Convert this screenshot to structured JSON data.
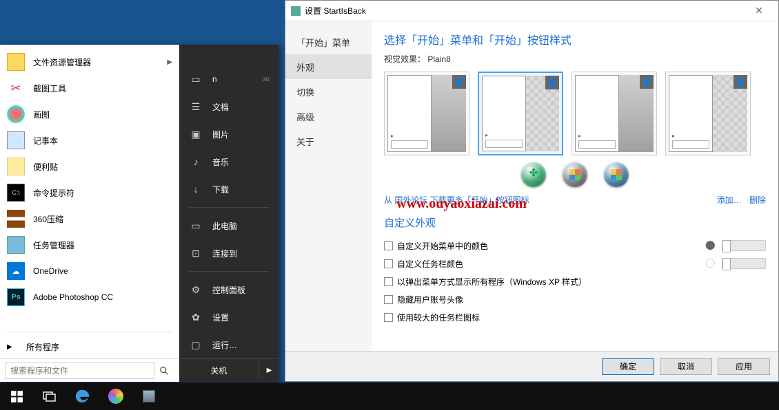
{
  "startMenu": {
    "left": [
      {
        "icon": "folder",
        "label": "文件资源管理器",
        "hasArrow": true
      },
      {
        "icon": "snip",
        "label": "截图工具"
      },
      {
        "icon": "paint",
        "label": "画图"
      },
      {
        "icon": "notepad",
        "label": "记事本"
      },
      {
        "icon": "sticky",
        "label": "便利贴"
      },
      {
        "icon": "cmd",
        "label": "命令提示符"
      },
      {
        "icon": "zip",
        "label": "360压缩"
      },
      {
        "icon": "task",
        "label": "任务管理器"
      },
      {
        "icon": "od",
        "label": "OneDrive"
      },
      {
        "icon": "ps",
        "label": "Adobe Photoshop CC"
      }
    ],
    "allPrograms": "所有程序",
    "searchPlaceholder": "搜索程序和文件",
    "right": [
      {
        "icon": "user",
        "label": "n",
        "extra": "ɜo"
      },
      {
        "icon": "doc",
        "label": "文档"
      },
      {
        "icon": "pic",
        "label": "图片"
      },
      {
        "icon": "music",
        "label": "音乐"
      },
      {
        "icon": "dl",
        "label": "下载"
      },
      {
        "divider": true
      },
      {
        "icon": "pc",
        "label": "此电脑"
      },
      {
        "icon": "net",
        "label": "连接到"
      },
      {
        "divider": true
      },
      {
        "icon": "cpl",
        "label": "控制面板"
      },
      {
        "icon": "set",
        "label": "设置"
      },
      {
        "icon": "run",
        "label": "运行…"
      }
    ],
    "shutdown": "关机"
  },
  "dialog": {
    "title": "设置 StartIsBack",
    "nav": [
      "「开始」菜单",
      "外观",
      "切换",
      "高级",
      "关于"
    ],
    "navActive": 1,
    "heading": "选择「开始」菜单和「开始」按钮样式",
    "visualLabel": "视觉效果：",
    "visualValue": "Plain8",
    "downloadLink": "从 国外论坛 下载更多「开始」按钮图标",
    "addLink": "添加…",
    "removeLink": "删除",
    "customHeading": "自定义外观",
    "checks": [
      "自定义开始菜单中的颜色",
      "自定义任务栏颜色",
      "以弹出菜单方式显示所有程序（Windows XP 样式）",
      "隐藏用户账号头像",
      "使用较大的任务栏图标"
    ],
    "btnOk": "确定",
    "btnCancel": "取消",
    "btnApply": "应用"
  },
  "watermark": "www.ouyaoxiazai.com"
}
